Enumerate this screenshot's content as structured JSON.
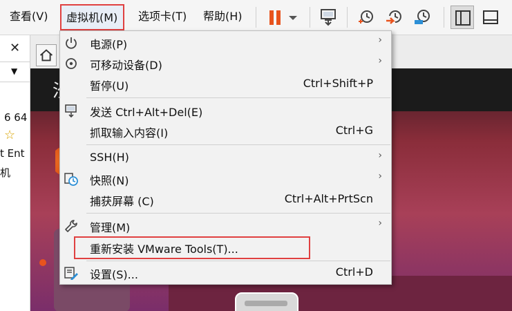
{
  "menubar": {
    "items": [
      {
        "label": "查看(V)"
      },
      {
        "label": "虚拟机(M)"
      },
      {
        "label": "选项卡(T)"
      },
      {
        "label": "帮助(H)"
      }
    ]
  },
  "toolbar": {
    "icons": [
      "pause-icon",
      "dropdown-arrow-icon",
      "send-ctrl-alt-del-icon",
      "snapshot-take-icon",
      "snapshot-revert-icon",
      "snapshot-manager-icon",
      "library-view-icon",
      "console-view-icon"
    ],
    "pause_color": "#e8531d",
    "accent_color": "#e8531d"
  },
  "leftpanel": {
    "close_glyph": "✕",
    "dropdown_glyph": "▼",
    "texts": [
      "6 64",
      "☆",
      "t Ent",
      "机"
    ]
  },
  "vm": {
    "topbar_text": "汐",
    "home_icon": "home-icon"
  },
  "menu": {
    "items": [
      {
        "label": "电源(P)",
        "accel": "",
        "submenu": true,
        "icon": "power-icon"
      },
      {
        "label": "可移动设备(D)",
        "accel": "",
        "submenu": true,
        "icon": "removable-device-icon"
      },
      {
        "label": "暂停(U)",
        "accel": "Ctrl+Shift+P",
        "submenu": false,
        "icon": ""
      },
      {
        "label": "发送 Ctrl+Alt+Del(E)",
        "accel": "",
        "submenu": false,
        "icon": "send-keys-icon"
      },
      {
        "label": "抓取输入内容(I)",
        "accel": "Ctrl+G",
        "submenu": false,
        "icon": ""
      },
      {
        "label": "SSH(H)",
        "accel": "",
        "submenu": true,
        "icon": ""
      },
      {
        "label": "快照(N)",
        "accel": "",
        "submenu": true,
        "icon": "snapshot-icon"
      },
      {
        "label": "捕获屏幕 (C)",
        "accel": "Ctrl+Alt+PrtScn",
        "submenu": false,
        "icon": ""
      },
      {
        "label": "管理(M)",
        "accel": "",
        "submenu": true,
        "icon": "wrench-icon"
      },
      {
        "label": "重新安装 VMware Tools(T)...",
        "accel": "",
        "submenu": false,
        "icon": ""
      },
      {
        "label": "设置(S)...",
        "accel": "Ctrl+D",
        "submenu": false,
        "icon": "settings-icon"
      }
    ],
    "submenu_glyph": "›"
  }
}
